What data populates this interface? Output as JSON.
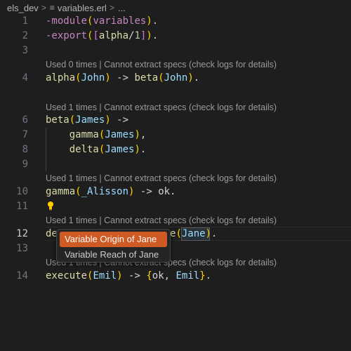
{
  "breadcrumb": {
    "folder": "els_dev",
    "sep1": ">",
    "file_icon": "lines-icon",
    "file": "variables.erl",
    "sep2": ">",
    "more": "..."
  },
  "lenses": {
    "l4": "Used 0 times | Cannot extract specs (check logs for details)",
    "l6": "Used 1 times | Cannot extract specs (check logs for details)",
    "l10": "Used 1 times | Cannot extract specs (check logs for details)",
    "l12": "Used 1 times | Cannot extract specs (check logs for details)",
    "l14": "Used 1 times | Cannot extract specs (check logs for details)"
  },
  "line_numbers": [
    "1",
    "2",
    "3",
    "4",
    "6",
    "7",
    "8",
    "9",
    "10",
    "11",
    "12",
    "13",
    "14"
  ],
  "code": {
    "l1": {
      "a": "-module",
      "b": "(",
      "c": "variables",
      "d": ")",
      "e": "."
    },
    "l2": {
      "a": "-export",
      "b": "(",
      "c": "[",
      "d": "alpha",
      "e": "/",
      "f": "1",
      "g": "]",
      "h": ")",
      "i": "."
    },
    "l4": {
      "a": "alpha",
      "b": "(",
      "c": "John",
      "d": ")",
      "e": " -> ",
      "f": "beta",
      "g": "(",
      "h": "John",
      "i": ")",
      "j": "."
    },
    "l6": {
      "a": "beta",
      "b": "(",
      "c": "James",
      "d": ")",
      "e": " ->"
    },
    "l7": {
      "a": "    ",
      "b": "gamma",
      "c": "(",
      "d": "James",
      "e": ")",
      "f": ","
    },
    "l8": {
      "a": "    ",
      "b": "delta",
      "c": "(",
      "d": "James",
      "e": ")",
      "f": "."
    },
    "l10": {
      "a": "gamma",
      "b": "(",
      "c": "_Alisson",
      "d": ")",
      "e": " -> ",
      "f": "ok",
      "g": "."
    },
    "l12": {
      "a": "de",
      "b": "e",
      "c": "(",
      "d": "Jane",
      "e": ")",
      "f": "."
    },
    "l14": {
      "a": "execute",
      "b": "(",
      "c": "Emil",
      "d": ")",
      "e": " -> ",
      "f": "{",
      "g": "ok",
      "h": ", ",
      "i": "Emil",
      "j": "}",
      "k": "."
    }
  },
  "menu": {
    "items": [
      "Variable Origin of Jane",
      "Variable Reach of Jane"
    ],
    "selected_index": 0
  },
  "colors": {
    "background": "#1e1e1e",
    "menu_selected": "#cf5a23",
    "function": "#dcdcaa",
    "variable": "#9cdcfe",
    "keyword": "#c586c0"
  }
}
